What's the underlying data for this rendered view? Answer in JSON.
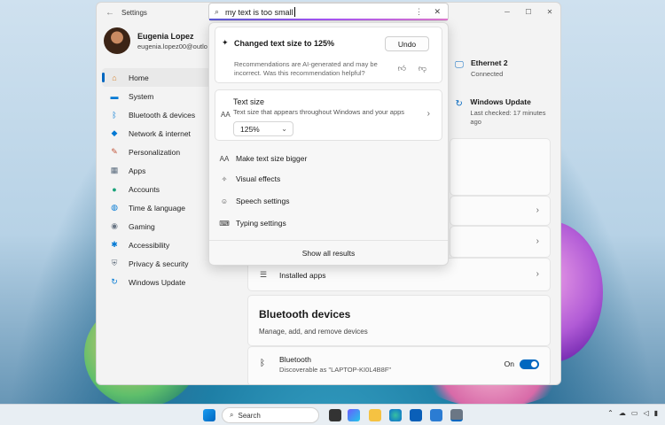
{
  "window": {
    "title": "Settings"
  },
  "profile": {
    "name": "Eugenia Lopez",
    "email": "eugenia.lopez00@outlo"
  },
  "nav": [
    {
      "label": "Home",
      "icon": "home-icon",
      "selected": true
    },
    {
      "label": "System",
      "icon": "display-icon"
    },
    {
      "label": "Bluetooth & devices",
      "icon": "bluetooth-icon"
    },
    {
      "label": "Network & internet",
      "icon": "wifi-icon"
    },
    {
      "label": "Personalization",
      "icon": "brush-icon"
    },
    {
      "label": "Apps",
      "icon": "apps-icon"
    },
    {
      "label": "Accounts",
      "icon": "person-icon"
    },
    {
      "label": "Time & language",
      "icon": "globe-icon"
    },
    {
      "label": "Gaming",
      "icon": "gamepad-icon"
    },
    {
      "label": "Accessibility",
      "icon": "accessibility-icon"
    },
    {
      "label": "Privacy & security",
      "icon": "shield-icon"
    },
    {
      "label": "Windows Update",
      "icon": "update-icon"
    }
  ],
  "status": {
    "ethernet": {
      "title": "Ethernet 2",
      "sub": "Connected"
    },
    "update": {
      "title": "Windows Update",
      "sub": "Last checked: 17 minutes ago"
    }
  },
  "content": {
    "installed_apps": "Installed apps",
    "bt_section": {
      "title": "Bluetooth devices",
      "subtitle": "Manage, add, and remove devices"
    },
    "bt_row": {
      "title": "Bluetooth",
      "sub": "Discoverable as \"LAPTOP-KI0L4B8F\"",
      "state": "On"
    }
  },
  "search": {
    "query": "my text is too small",
    "recommendation": {
      "title": "Changed text size to 125%",
      "undo": "Undo",
      "note": "Recommendations are AI-generated and may be incorrect. Was this recommendation helpful?"
    },
    "text_size": {
      "title": "Text size",
      "sub": "Text size that appears throughout Windows and your apps",
      "value": "125%"
    },
    "results": [
      {
        "label": "Make text size bigger",
        "icon": "text-size-icon"
      },
      {
        "label": "Visual effects",
        "icon": "visual-effects-icon"
      },
      {
        "label": "Speech settings",
        "icon": "speech-icon"
      },
      {
        "label": "Typing settings",
        "icon": "keyboard-icon"
      }
    ],
    "show_all": "Show all results"
  },
  "taskbar": {
    "search_label": "Search"
  }
}
